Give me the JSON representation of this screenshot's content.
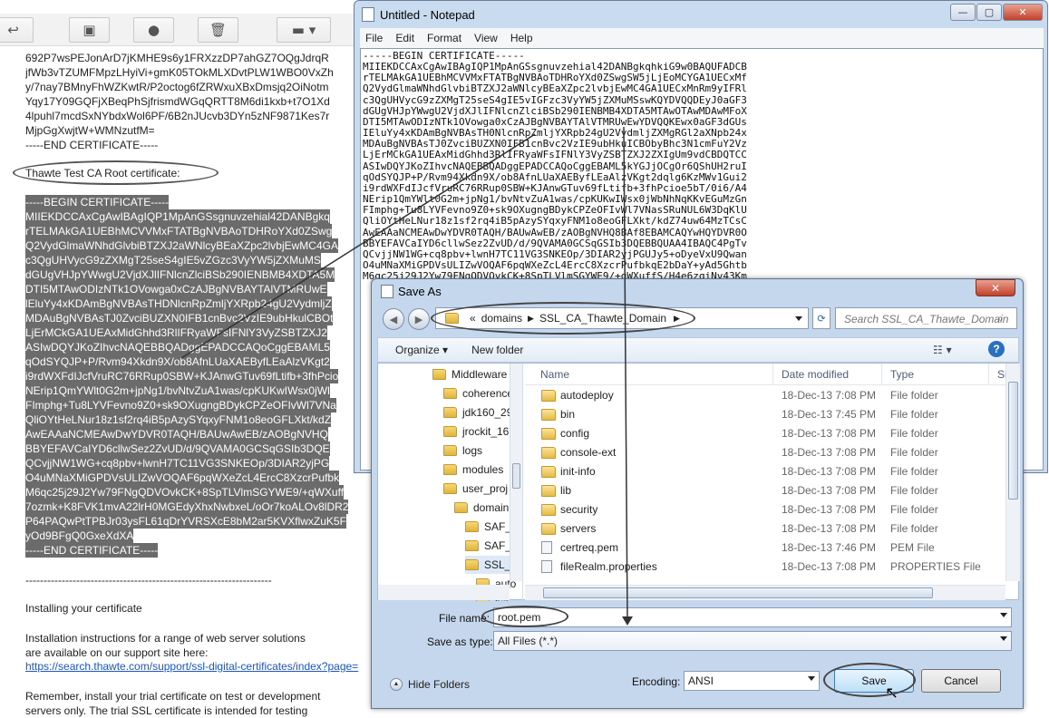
{
  "email": {
    "cert_top_lines": [
      "692P7wsPEJonArD7jKMHE9s6y1FRXzzDP7ahGZ7OQgJdrqR",
      "jfWb3vTZUMFMpzLHyiVi+gmK05TOkMLXDvtPLW1WBO0VxZh",
      "y/7nay7BMnyFhWZKwtR/P2octog6fZRWxuXBxDmsjq2OiNotm",
      "Yqy17Y09GQFjXBeqPhSjfrismdWGqQRTT8M6di1kxb+t7O1Xd",
      "4lpuhl7mcdSxNYbdxWol6PF/6B2nJUcvb3DYn5zNF9871Kes7r",
      "MjpGgXwjtW+WMNzutfM=",
      "-----END CERTIFICATE-----"
    ],
    "thawte_label": "Thawte Test CA Root certificate:",
    "cert_selected_lines": [
      "-----BEGIN CERTIFICATE-----",
      "MIIEKDCCAxCgAwIBAgIQP1MpAnGSsgnuvzehial42DANBgkq",
      "rTELMAkGA1UEBhMCVVMxFTATBgNVBAoTDHRoYXd0ZSwg",
      "Q2VydGlmaWNhdGlvbiBTZXJ2aWNlcyBEaXZpc2lvbjEwMC4GA",
      "c3QgUHVycG9zZXMgT25seS4gIE5vZGzc3VyYW5jZXMuMS",
      "dGUgVHJpYWwgU2VjdXJlIFNlcnZlciBSb290IENBMB4XDTA5M",
      "DTI5MTAwODIzNTk1OVowga0xCzAJBgNVBAYTAlVTMRUwE",
      "lEluYy4xKDAmBgNVBAsTHDNlcnRpZmljYXRpb24gU2VydmljZ",
      "MDAuBgNVBAsTJ0ZvciBUZXN0IFB1cnBvc2VzIE9ubHkulCBOt",
      "LjErMCkGA1UEAxMidGhhd3RlIFRyaWFsIFNlY3VyZSBTZXJ2",
      "ASIwDQYJKoZIhvcNAQEBBQADggEPADCCAQoCggEBAML5",
      "qOdSYQJP+P/Rvm94Xkdn9X/ob8AfnLUaXAEByfLEaAlzVKgt2",
      "i9rdWXFdIJcfVruRC76RRup0SBW+KJAnwGTuv69fLtifb+3fhPcio",
      "NErip1QmYWlt0G2m+jpNg1/bvNtvZuA1was/cpKUKwIWsx0jWl",
      "FImphg+Tu8LYVFevno9Z0+sk9OXugngBDykCPZeOFIvWl7VNa",
      "QliOYtHeLNur18z1sf2rq4iB5pAzySYqxyFNM1o8eoGFLXkt/kdZ",
      "AwEAAaNCMEAwDwYDVR0TAQH/BAUwAwEB/zAOBgNVHQ",
      "BBYEFAVCaIYD6cllwSez2ZvUD/d/9QVAMA0GCSqGSIb3DQE",
      "QCvjjNW1WG+cq8pbv+lwnH7TC11VG3SNKEOp/3DIAR2yjPG",
      "O4uMNaXMiGPDVsULIZwVOQAF6pqWXeZcL4ErcC8XzcrPufbk",
      "M6qc25j29J2Yw79FNgQDVOvkCK+8SpTLVlmSGYWE9/+qWXuff",
      "7ozmk+K8FVK1mvA22lrH0MGEdyXhxNwbxeL/oOr7koALOv8lDR2",
      "P64PAQwPtTPBJr03ysFL61qDrYVRSXcE8bM2ar5KVXflwxZuK5F",
      "yOd9BFgQ0GxeXdXA",
      "-----END CERTIFICATE-----"
    ],
    "dash_line": "--------------------------------------------------------------------",
    "install_title": "Installing your certificate",
    "instr_line1": "Installation instructions for a range of web server solutions",
    "instr_line2": "are available on our support site here:",
    "support_link": "https://search.thawte.com/support/ssl-digital-certificates/index?page=",
    "remember_line1": "Remember, install your trial certificate on test or development",
    "remember_line2": "servers only. The trial SSL certificate is intended for testing"
  },
  "notepad": {
    "title": "Untitled - Notepad",
    "menu": [
      "File",
      "Edit",
      "Format",
      "View",
      "Help"
    ],
    "lines": [
      "-----BEGIN CERTIFICATE-----",
      "MIIEKDCCAxCgAwIBAgIQP1MpAnGSsgnuvzehial42DANBgkqhkiG9w0BAQUFADCB",
      "rTELMAkGA1UEBhMCVVMxFTATBgNVBAoTDHRoYXd0ZSwgSW5jLjEoMCYGA1UECxMf",
      "Q2VydGlmaWNhdGlvbiBTZXJ2aWNlcyBEaXZpc2lvbjEwMC4GA1UECxMnRm9yIFRl",
      "c3QgUHVycG9zZXMgT25seS4gIE5vIGFzc3VyYW5jZXMuMSswKQYDVQQDEyJ0aGF3",
      "dGUgVHJpYWwgU2VjdXJlIFNlcnZlciBSb290IENBMB4XDTA5MTAwOTAwMDAwMFoX",
      "DTI5MTAwODIzNTk1OVowga0xCzAJBgNVBAYTAlVTMRUwEwYDVQQKEwx0aGF3dGUs",
      "IEluYy4xKDAmBgNVBAsTH0NlcnRpZmljYXRpb24gU2VydmljZXMgRGl2aXNpb24x",
      "MDAuBgNVBAsTJ0ZvciBUZXN0IFB1cnBvc2VzIE9ubHkuICBObyBhc3N1cmFuY2Vz",
      "LjErMCkGA1UEAxMidGhhd3RlIFRyaWFsIFNlY3VyZSBTZXJ2ZXIgUm9vdCBDQTCC",
      "ASIwDQYJKoZIhvcNAQEBBQADggEPADCCAQoCggEBAML5kYGJjOCgOr6QShUH2ruI",
      "qOdSYQJP+P/Rvm94Xkdn9X/ob8AfnLUaXAEByfLEaAlzVKgt2dqlg6KzMWv1Gui2",
      "i9rdWXFdIJcfVruRC76RRup0SBW+KJAnwGTuv69fLtifb+3fhPcioe5bT/0i6/A4",
      "NErip1QmYWlt0G2m+jpNg1/bvNtvZuA1was/cpKUKwIWsx0jWbNhNqKKvEGuMzGn",
      "FImphg+Tu8LYVFevno9Z0+sk9OXugngBDykCPZeOFIvWl7VNasSRuNUL6W3DqKlU",
      "QliOYtHeLNur18z1sf2rq4iB5pAzySYqxyFNM1o8eoGFLXkt/kdZ74uw64MzTCsC",
      "AwEAAaNCMEAwDwYDVR0TAQH/BAUwAwEB/zAOBgNVHQ8BAf8EBAMCAQYwHQYDVR0O",
      "BBYEFAVCaIYD6cllwSez2ZvUD/d/9QVAMA0GCSqGSIb3DQEBBQUAA4IBAQC4PgTv",
      "QCvjjNW1WG+cq8pbv+lwnH7TC11VG3SNKEOp/3DIAR2yjPGUJy5+oDyeVxU9Qwan",
      "O4uMNaXMiGPDVsULIZwVOQAF6pqWXeZcL4ErcC8XzcrPufbkqE2bDaY+yAd5Ghtb",
      "M6qc25j29J2Yw79FNgQDVOvkCK+8SpTLVlmSGYWE9/+qWXuffS/H4e6zqiNv43Km"
    ],
    "window_buttons": [
      "—",
      "▢",
      "✕"
    ]
  },
  "save_as": {
    "title": "Save As",
    "breadcrumb_prefix": "«",
    "breadcrumb": [
      "domains",
      "SSL_CA_Thawte_Domain"
    ],
    "search_placeholder": "Search SSL_CA_Thawte_Domain",
    "toolbar": {
      "organize": "Organize",
      "new_folder": "New folder"
    },
    "tree": [
      "Middleware",
      "coherence",
      "jdk160_29",
      "jrockit_16",
      "logs",
      "modules",
      "user_proj",
      "domain",
      "SAF_D",
      "SAF_S",
      "SSL_C",
      "auto",
      "bin"
    ],
    "columns": {
      "name": "Name",
      "date": "Date modified",
      "type": "Type",
      "size": "Si"
    },
    "files": [
      {
        "name": "autodeploy",
        "date": "18-Dec-13 7:08 PM",
        "type": "File folder",
        "kind": "folder"
      },
      {
        "name": "bin",
        "date": "18-Dec-13 7:45 PM",
        "type": "File folder",
        "kind": "folder"
      },
      {
        "name": "config",
        "date": "18-Dec-13 7:08 PM",
        "type": "File folder",
        "kind": "folder"
      },
      {
        "name": "console-ext",
        "date": "18-Dec-13 7:08 PM",
        "type": "File folder",
        "kind": "folder"
      },
      {
        "name": "init-info",
        "date": "18-Dec-13 7:08 PM",
        "type": "File folder",
        "kind": "folder"
      },
      {
        "name": "lib",
        "date": "18-Dec-13 7:08 PM",
        "type": "File folder",
        "kind": "folder"
      },
      {
        "name": "security",
        "date": "18-Dec-13 7:08 PM",
        "type": "File folder",
        "kind": "folder"
      },
      {
        "name": "servers",
        "date": "18-Dec-13 7:08 PM",
        "type": "File folder",
        "kind": "folder"
      },
      {
        "name": "certreq.pem",
        "date": "18-Dec-13 7:46 PM",
        "type": "PEM File",
        "kind": "file"
      },
      {
        "name": "fileRealm.properties",
        "date": "18-Dec-13 7:08 PM",
        "type": "PROPERTIES File",
        "kind": "file"
      }
    ],
    "file_name_label": "File name:",
    "file_name_value": "root.pem",
    "save_type_label": "Save as type:",
    "save_type_value": "All Files  (*.*)",
    "hide_folders": "Hide Folders",
    "encoding_label": "Encoding:",
    "encoding_value": "ANSI",
    "save_button": "Save",
    "cancel_button": "Cancel"
  }
}
